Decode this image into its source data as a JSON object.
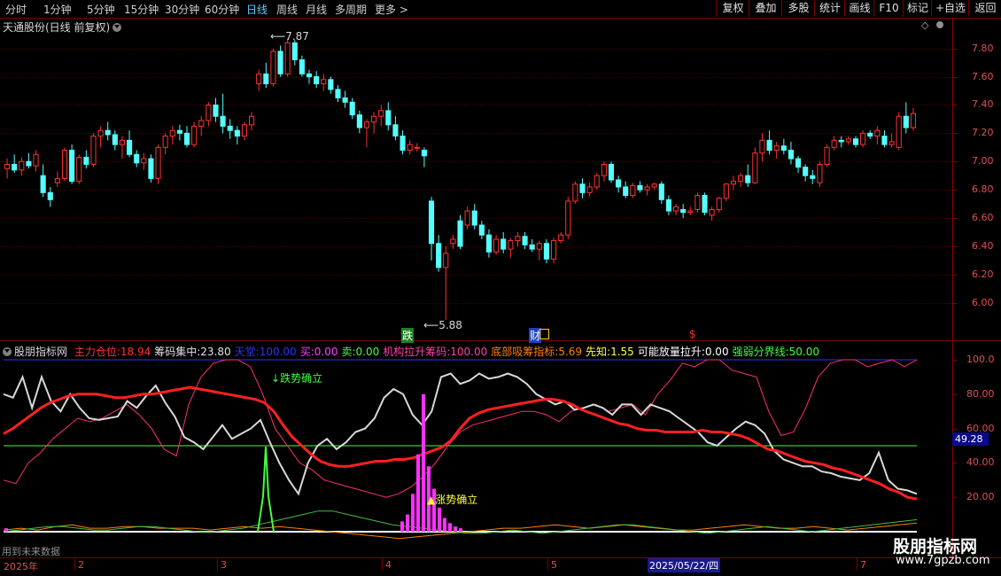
{
  "toolbar": {
    "periods": [
      "分时",
      "1分钟",
      "5分钟",
      "15分钟",
      "30分钟",
      "60分钟",
      "日线",
      "周线",
      "月线",
      "多周期",
      "更多"
    ],
    "selected": "日线",
    "right_buttons": [
      "复权",
      "叠加",
      "多股",
      "统计",
      "画线",
      "F10",
      "标记",
      "+自选",
      "返回"
    ]
  },
  "main_chart": {
    "title": "天通股份(日线 前复权)",
    "high_label": "7.87",
    "low_label": "5.88",
    "marker_drop": "跌",
    "marker_fin": "财",
    "marker_s": "$",
    "y_ticks": [
      "7.80",
      "7.60",
      "7.40",
      "7.20",
      "7.00",
      "6.80",
      "6.60",
      "6.40",
      "6.20",
      "6.00"
    ],
    "y_min": 5.76,
    "y_max": 7.98
  },
  "indicator": {
    "name": "股朋指标网",
    "legend": [
      {
        "label": "主力仓位:",
        "value": "18.94",
        "color": "#ff3030"
      },
      {
        "label": "筹码集中:",
        "value": "23.80",
        "color": "#e0e0e0"
      },
      {
        "label": "天堂:",
        "value": "100.00",
        "color": "#3030ff"
      },
      {
        "label": "买:",
        "value": "0.00",
        "color": "#ff40ff"
      },
      {
        "label": "卖:",
        "value": "0.00",
        "color": "#40ff40"
      },
      {
        "label": "机构拉升筹码:",
        "value": "100.00",
        "color": "#ff40a0"
      },
      {
        "label": "底部吸筹指标:",
        "value": "5.69",
        "color": "#ff8000"
      },
      {
        "label": "先知:",
        "value": "1.55",
        "color": "#ffff40"
      },
      {
        "label": "可能放量拉升:",
        "value": "0.00",
        "color": "#ffffff"
      },
      {
        "label": "强弱分界线:",
        "value": "50.00",
        "color": "#40ff40"
      }
    ],
    "annotation_down": "跌势确立",
    "annotation_up": "涨势确立",
    "y_ticks": [
      "100.0",
      "80.00",
      "60.00",
      "40.00",
      "20.00"
    ],
    "current_value": "49.28",
    "y_min": 0,
    "y_max": 102
  },
  "bottom": {
    "future_label": "用到未来数据",
    "x_labels": [
      "2025年",
      "2",
      "3",
      "4",
      "5",
      "2025/05/22/四",
      "7"
    ]
  },
  "watermark": {
    "line1": "股朋指标网",
    "line2": "www.7gpzb.com"
  },
  "colors": {
    "up": "#ff3232",
    "down": "#54ffff",
    "bg": "#000000",
    "axis": "#8b0000"
  },
  "chart_data": {
    "type": "candlestick",
    "candles": [
      [
        6.95,
        7.02,
        6.88,
        6.98
      ],
      [
        6.98,
        7.05,
        6.92,
        6.94
      ],
      [
        6.94,
        7.03,
        6.9,
        7.0
      ],
      [
        7.0,
        7.06,
        6.95,
        6.97
      ],
      [
        6.97,
        7.08,
        6.93,
        7.05
      ],
      [
        6.9,
        6.98,
        6.75,
        6.78
      ],
      [
        6.78,
        6.82,
        6.68,
        6.73
      ],
      [
        6.85,
        6.93,
        6.82,
        6.88
      ],
      [
        6.88,
        7.1,
        6.86,
        7.08
      ],
      [
        7.08,
        7.12,
        6.84,
        6.86
      ],
      [
        6.86,
        7.05,
        6.84,
        7.03
      ],
      [
        7.03,
        7.08,
        6.95,
        6.98
      ],
      [
        6.98,
        7.2,
        6.96,
        7.18
      ],
      [
        7.18,
        7.25,
        7.1,
        7.22
      ],
      [
        7.22,
        7.28,
        7.15,
        7.19
      ],
      [
        7.19,
        7.22,
        7.08,
        7.12
      ],
      [
        7.12,
        7.18,
        7.02,
        7.15
      ],
      [
        7.15,
        7.22,
        7.03,
        7.05
      ],
      [
        7.05,
        7.08,
        6.96,
        6.99
      ],
      [
        6.99,
        7.06,
        6.94,
        7.02
      ],
      [
        7.02,
        7.05,
        6.85,
        6.88
      ],
      [
        6.88,
        7.12,
        6.84,
        7.1
      ],
      [
        7.1,
        7.2,
        7.05,
        7.18
      ],
      [
        7.18,
        7.25,
        7.12,
        7.22
      ],
      [
        7.22,
        7.26,
        7.15,
        7.2
      ],
      [
        7.2,
        7.25,
        7.1,
        7.12
      ],
      [
        7.12,
        7.28,
        7.1,
        7.25
      ],
      [
        7.25,
        7.32,
        7.18,
        7.29
      ],
      [
        7.29,
        7.42,
        7.25,
        7.4
      ],
      [
        7.4,
        7.45,
        7.28,
        7.32
      ],
      [
        7.32,
        7.48,
        7.2,
        7.25
      ],
      [
        7.25,
        7.3,
        7.16,
        7.22
      ],
      [
        7.22,
        7.25,
        7.12,
        7.18
      ],
      [
        7.18,
        7.28,
        7.15,
        7.26
      ],
      [
        7.26,
        7.35,
        7.22,
        7.32
      ],
      [
        7.55,
        7.65,
        7.5,
        7.62
      ],
      [
        7.62,
        7.7,
        7.52,
        7.55
      ],
      [
        7.55,
        7.8,
        7.53,
        7.78
      ],
      [
        7.78,
        7.82,
        7.6,
        7.62
      ],
      [
        7.62,
        7.87,
        7.6,
        7.84
      ],
      [
        7.84,
        7.86,
        7.68,
        7.72
      ],
      [
        7.72,
        7.75,
        7.6,
        7.62
      ],
      [
        7.62,
        7.65,
        7.55,
        7.6
      ],
      [
        7.6,
        7.64,
        7.52,
        7.55
      ],
      [
        7.55,
        7.62,
        7.5,
        7.58
      ],
      [
        7.58,
        7.6,
        7.48,
        7.51
      ],
      [
        7.51,
        7.54,
        7.42,
        7.45
      ],
      [
        7.45,
        7.5,
        7.38,
        7.42
      ],
      [
        7.42,
        7.45,
        7.3,
        7.33
      ],
      [
        7.33,
        7.36,
        7.2,
        7.24
      ],
      [
        7.24,
        7.3,
        7.1,
        7.28
      ],
      [
        7.28,
        7.35,
        7.2,
        7.32
      ],
      [
        7.32,
        7.4,
        7.25,
        7.36
      ],
      [
        7.36,
        7.42,
        7.22,
        7.26
      ],
      [
        7.26,
        7.32,
        7.15,
        7.18
      ],
      [
        7.18,
        7.22,
        7.05,
        7.08
      ],
      [
        7.08,
        7.15,
        7.05,
        7.12
      ],
      [
        7.1,
        7.13,
        7.07,
        7.1
      ],
      [
        7.08,
        7.1,
        6.96,
        7.04
      ],
      [
        6.72,
        6.75,
        6.3,
        6.42
      ],
      [
        6.42,
        6.48,
        6.22,
        6.25
      ],
      [
        6.25,
        6.4,
        5.88,
        6.35
      ],
      [
        6.42,
        6.48,
        6.38,
        6.45
      ],
      [
        6.58,
        6.62,
        6.38,
        6.4
      ],
      [
        6.55,
        6.68,
        6.52,
        6.65
      ],
      [
        6.65,
        6.7,
        6.52,
        6.55
      ],
      [
        6.55,
        6.58,
        6.45,
        6.48
      ],
      [
        6.48,
        6.52,
        6.32,
        6.36
      ],
      [
        6.36,
        6.48,
        6.34,
        6.45
      ],
      [
        6.45,
        6.5,
        6.35,
        6.38
      ],
      [
        6.38,
        6.46,
        6.32,
        6.44
      ],
      [
        6.44,
        6.5,
        6.4,
        6.47
      ],
      [
        6.47,
        6.5,
        6.38,
        6.41
      ],
      [
        6.41,
        6.45,
        6.36,
        6.38
      ],
      [
        6.38,
        6.44,
        6.3,
        6.42
      ],
      [
        6.42,
        6.45,
        6.28,
        6.31
      ],
      [
        6.31,
        6.46,
        6.28,
        6.44
      ],
      [
        6.44,
        6.5,
        6.42,
        6.48
      ],
      [
        6.48,
        6.75,
        6.45,
        6.72
      ],
      [
        6.72,
        6.86,
        6.7,
        6.84
      ],
      [
        6.84,
        6.88,
        6.74,
        6.78
      ],
      [
        6.78,
        6.85,
        6.75,
        6.82
      ],
      [
        6.82,
        6.92,
        6.8,
        6.9
      ],
      [
        6.9,
        7.0,
        6.86,
        6.98
      ],
      [
        6.98,
        7.0,
        6.85,
        6.87
      ],
      [
        6.87,
        6.9,
        6.78,
        6.82
      ],
      [
        6.82,
        6.86,
        6.74,
        6.76
      ],
      [
        6.76,
        6.85,
        6.74,
        6.83
      ],
      [
        6.83,
        6.86,
        6.78,
        6.8
      ],
      [
        6.8,
        6.84,
        6.76,
        6.82
      ],
      [
        6.82,
        6.85,
        6.8,
        6.84
      ],
      [
        6.84,
        6.86,
        6.7,
        6.73
      ],
      [
        6.73,
        6.76,
        6.62,
        6.65
      ],
      [
        6.65,
        6.7,
        6.62,
        6.68
      ],
      [
        6.66,
        6.7,
        6.6,
        6.64
      ],
      [
        6.64,
        6.68,
        6.62,
        6.65
      ],
      [
        6.66,
        6.78,
        6.64,
        6.76
      ],
      [
        6.76,
        6.78,
        6.62,
        6.64
      ],
      [
        6.62,
        6.68,
        6.58,
        6.66
      ],
      [
        6.66,
        6.75,
        6.64,
        6.74
      ],
      [
        6.74,
        6.85,
        6.72,
        6.84
      ],
      [
        6.84,
        6.9,
        6.8,
        6.86
      ],
      [
        6.86,
        6.92,
        6.82,
        6.9
      ],
      [
        6.9,
        6.98,
        6.82,
        6.85
      ],
      [
        6.85,
        7.1,
        6.84,
        7.06
      ],
      [
        7.06,
        7.2,
        7.0,
        7.15
      ],
      [
        7.15,
        7.22,
        7.05,
        7.08
      ],
      [
        7.08,
        7.14,
        7.02,
        7.11
      ],
      [
        7.11,
        7.16,
        7.05,
        7.08
      ],
      [
        7.08,
        7.14,
        6.98,
        7.02
      ],
      [
        7.02,
        7.04,
        6.92,
        6.96
      ],
      [
        6.96,
        6.98,
        6.86,
        6.9
      ],
      [
        6.9,
        6.94,
        6.84,
        6.88
      ],
      [
        6.85,
        7.0,
        6.82,
        6.98
      ],
      [
        6.98,
        7.12,
        6.96,
        7.1
      ],
      [
        7.1,
        7.18,
        7.08,
        7.15
      ],
      [
        7.15,
        7.18,
        7.1,
        7.14
      ],
      [
        7.14,
        7.18,
        7.12,
        7.16
      ],
      [
        7.16,
        7.18,
        7.1,
        7.12
      ],
      [
        7.12,
        7.22,
        7.1,
        7.2
      ],
      [
        7.2,
        7.22,
        7.16,
        7.18
      ],
      [
        7.18,
        7.25,
        7.12,
        7.22
      ],
      [
        7.18,
        7.22,
        7.1,
        7.12
      ],
      [
        7.12,
        7.2,
        7.1,
        7.14
      ],
      [
        7.1,
        7.35,
        7.08,
        7.32
      ],
      [
        7.32,
        7.42,
        7.2,
        7.24
      ],
      [
        7.24,
        7.38,
        7.22,
        7.34
      ]
    ],
    "series": [
      {
        "name": "主力仓位",
        "values": [
          57,
          60,
          64,
          68,
          72,
          75,
          77,
          79,
          80,
          80,
          80,
          79,
          78,
          78,
          79,
          80,
          80,
          81,
          82,
          83,
          84,
          83,
          82,
          81,
          80,
          79,
          78,
          77,
          75,
          70,
          62,
          55,
          50,
          45,
          41,
          39,
          38,
          38,
          39,
          40,
          41,
          41,
          42,
          42,
          43,
          45,
          47,
          49,
          53,
          60,
          66,
          69,
          71,
          72,
          73,
          74,
          75,
          76,
          77,
          77,
          76,
          74,
          71,
          69,
          67,
          65,
          63,
          62,
          60,
          59,
          59,
          58,
          58,
          58,
          58,
          59,
          58,
          58,
          57,
          56,
          54,
          51,
          48,
          47,
          45,
          43,
          41,
          40,
          39,
          37,
          36,
          34,
          32,
          30,
          28,
          25,
          23,
          20,
          19
        ]
      },
      {
        "name": "筹码集中",
        "values": [
          80,
          78,
          90,
          72,
          90,
          76,
          70,
          80,
          72,
          66,
          65,
          66,
          67,
          76,
          72,
          79,
          85,
          75,
          67,
          55,
          52,
          48,
          55,
          62,
          54,
          57,
          60,
          65,
          52,
          40,
          30,
          22,
          40,
          50,
          54,
          48,
          52,
          58,
          60,
          66,
          78,
          83,
          80,
          68,
          62,
          70,
          90,
          92,
          86,
          88,
          92,
          89,
          90,
          92,
          90,
          86,
          80,
          77,
          74,
          76,
          71,
          72,
          74,
          72,
          68,
          74,
          74,
          68,
          74,
          72,
          70,
          66,
          62,
          58,
          52,
          50,
          55,
          60,
          64,
          62,
          57,
          47,
          42,
          40,
          38,
          38,
          35,
          34,
          32,
          31,
          30,
          34,
          46,
          30,
          25,
          24,
          22
        ]
      },
      {
        "name": "机构拉升筹码",
        "values": [
          30,
          28,
          40,
          46,
          54,
          60,
          66,
          64,
          66,
          70,
          74,
          68,
          60,
          48,
          44,
          74,
          90,
          98,
          100,
          100,
          96,
          80,
          60,
          50,
          40,
          36,
          30,
          28,
          26,
          24,
          22,
          20,
          22,
          26,
          32,
          40,
          50,
          58,
          62,
          64,
          66,
          68,
          70,
          70,
          68,
          64,
          70,
          72,
          74,
          70,
          72,
          74,
          68,
          80,
          88,
          98,
          96,
          100,
          100,
          94,
          92,
          90,
          70,
          56,
          58,
          72,
          90,
          98,
          100,
          100,
          96,
          98,
          100,
          96,
          100
        ]
      },
      {
        "name": "底部吸筹指标",
        "values": [
          1,
          2,
          1,
          3,
          4,
          2,
          2,
          3,
          3,
          2,
          2,
          2,
          1,
          2,
          3,
          2,
          3,
          2,
          1,
          0,
          -1,
          -2,
          -3,
          -4,
          -3,
          -2,
          -1,
          0,
          1,
          2,
          2,
          3,
          4,
          3,
          2,
          3,
          4,
          3,
          2,
          1,
          1,
          2,
          3,
          4,
          3,
          2,
          2,
          3,
          2,
          1,
          2,
          3,
          4,
          5
        ]
      },
      {
        "name": "卖",
        "values": [
          0,
          1,
          2,
          3,
          3,
          2,
          1,
          1,
          2,
          3,
          3,
          2,
          1,
          0,
          0,
          1,
          2,
          4,
          6,
          8,
          10,
          12,
          12,
          10,
          8,
          6,
          4,
          3,
          2,
          1,
          0,
          -1,
          -1,
          0,
          1,
          0,
          -1,
          0,
          1,
          2,
          3,
          4,
          4,
          3,
          2,
          1,
          0,
          -1,
          0,
          1,
          2,
          3,
          2,
          1,
          0,
          1,
          2,
          3,
          4,
          5,
          6,
          7
        ]
      },
      {
        "name": "强弱分界线",
        "values": [
          50
        ]
      },
      {
        "name": "天堂",
        "values": [
          100
        ]
      },
      {
        "name": "可能放量拉升",
        "values": [
          0
        ]
      }
    ]
  }
}
